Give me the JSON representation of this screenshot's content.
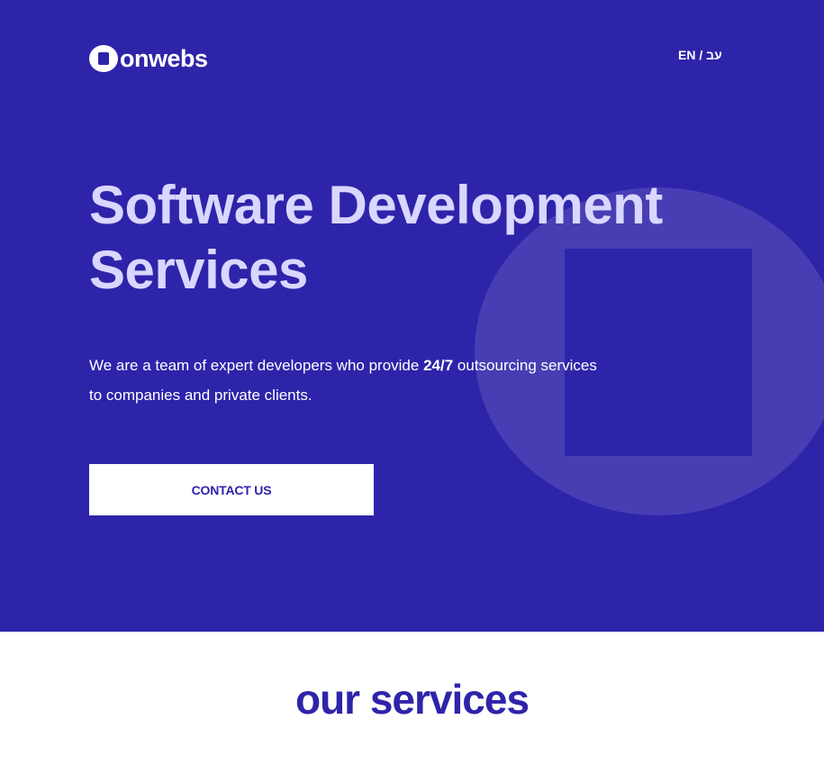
{
  "header": {
    "logo_text": "onwebs",
    "lang_en": "EN",
    "lang_sep": "/",
    "lang_he": "עב"
  },
  "hero": {
    "title_line1": "Software Development",
    "title_line2": "Services",
    "desc_before": "We are a team of expert developers who provide",
    "desc_bold": "24/7",
    "desc_after": "outsourcing services",
    "desc_line2": "to companies and private clients.",
    "cta_label": "CONTACT US"
  },
  "services": {
    "title": "our services"
  },
  "colors": {
    "brand": "#2e24aa",
    "title_light": "#d9d6ff",
    "white": "#ffffff"
  }
}
